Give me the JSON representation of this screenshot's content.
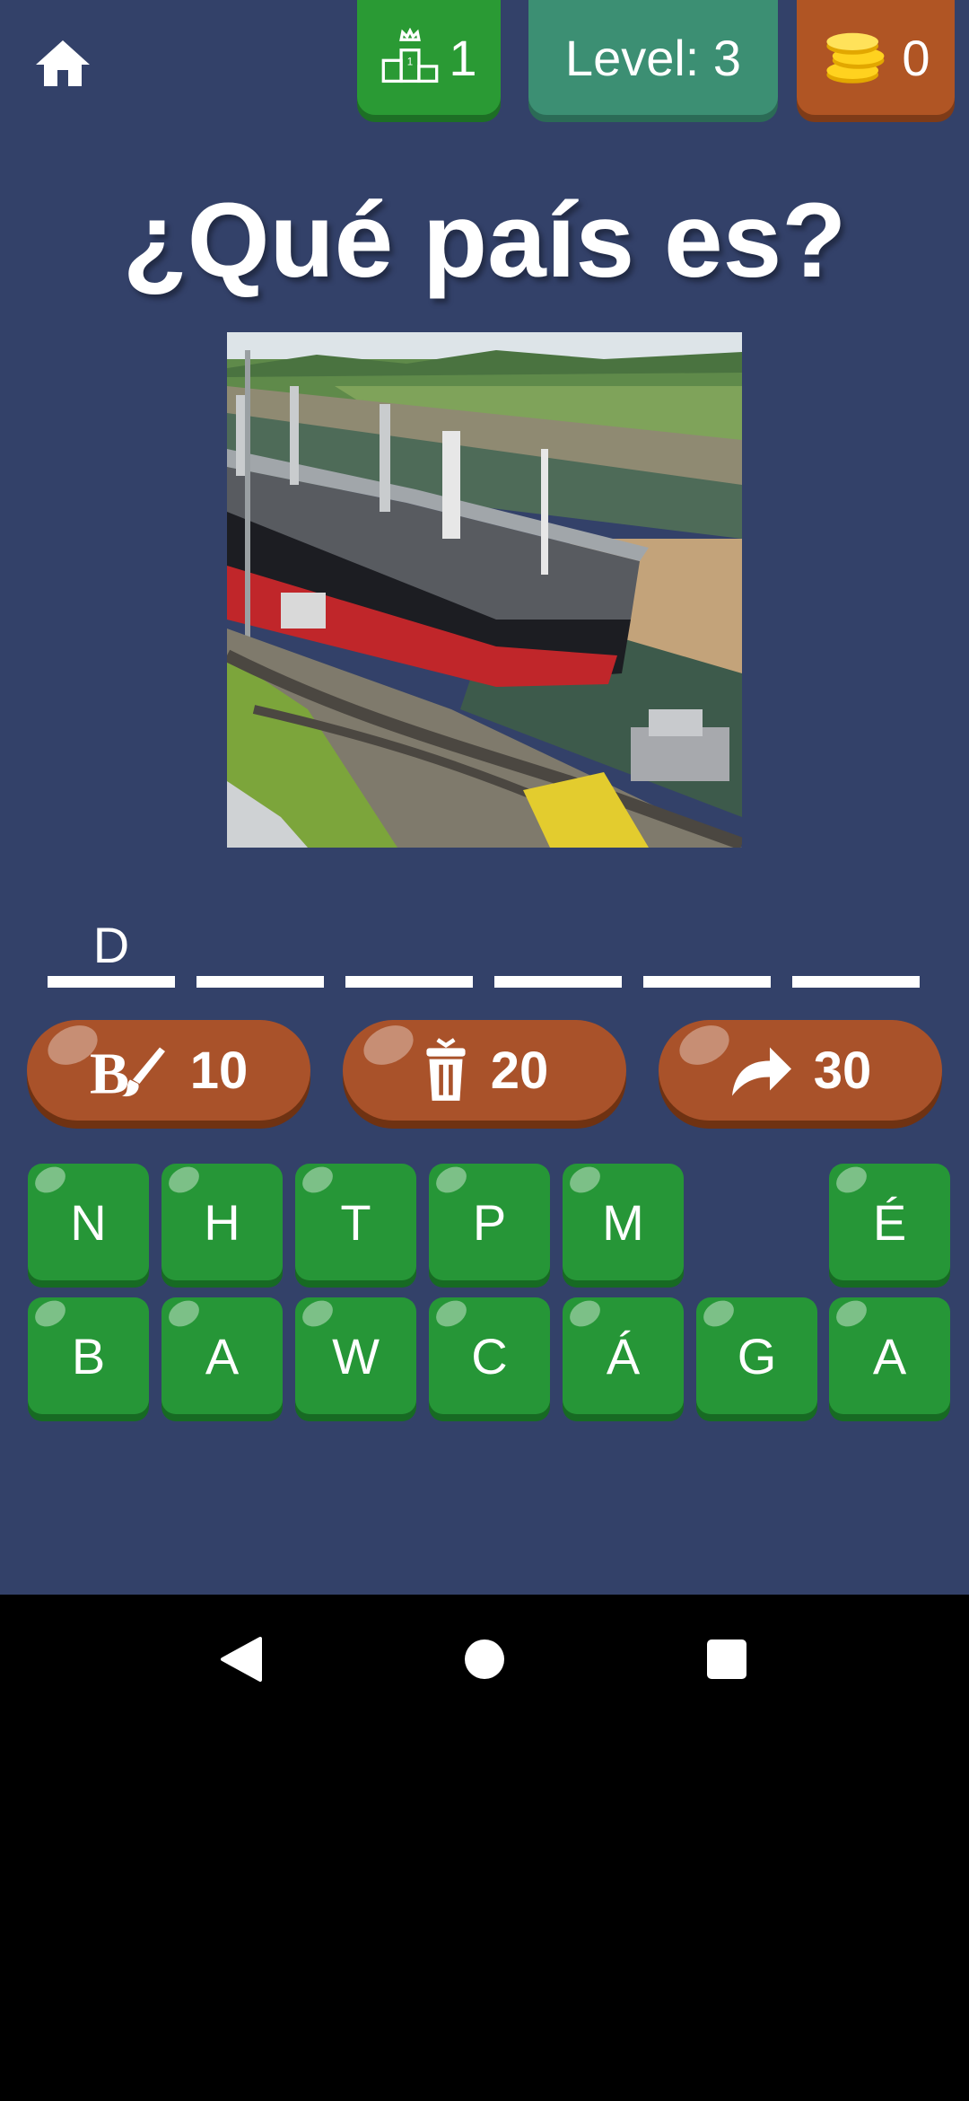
{
  "header": {
    "rank_value": "1",
    "level_text": "Level: 3",
    "coins_value": "0",
    "home_icon": "home-icon",
    "rank_icon": "podium-crown-icon",
    "coins_icon": "coin-stack-icon"
  },
  "question": {
    "title": "¿Qué país es?",
    "image": "Ship passing through canal locks"
  },
  "answer": {
    "slots": [
      "D",
      "",
      "",
      "",
      "",
      ""
    ]
  },
  "powerups": [
    {
      "icon": "paint-brush-icon",
      "cost": "10"
    },
    {
      "icon": "trash-icon",
      "cost": "20"
    },
    {
      "icon": "skip-arrow-icon",
      "cost": "30"
    }
  ],
  "keyboard": {
    "row1": [
      "N",
      "H",
      "T",
      "P",
      "M",
      "",
      "É"
    ],
    "row2": [
      "B",
      "A",
      "W",
      "C",
      "Á",
      "G",
      "A"
    ]
  },
  "colors": {
    "background": "#334169",
    "green_key": "#269637",
    "power_button": "#a9522a",
    "level_pill": "#3c8f73",
    "coins_pill": "#b05524"
  }
}
